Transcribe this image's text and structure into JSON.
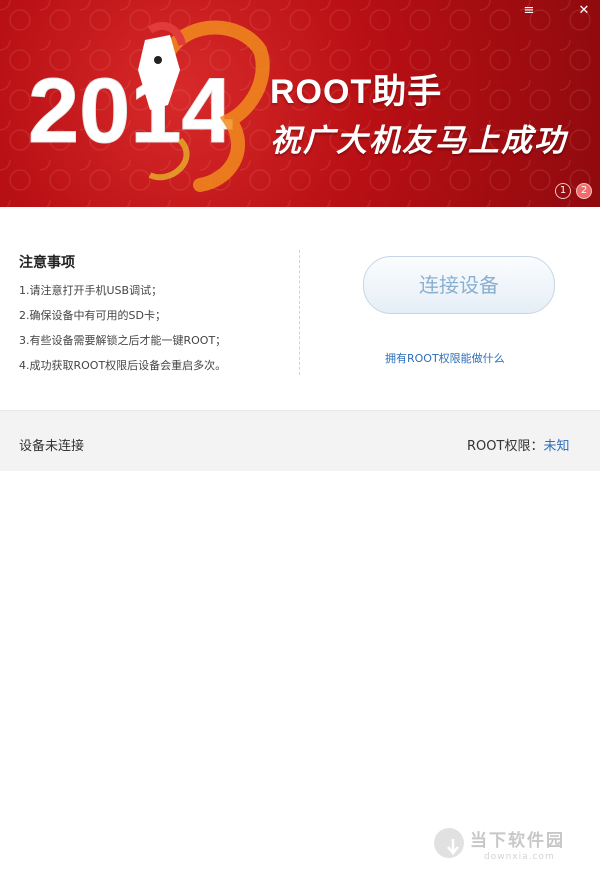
{
  "window": {
    "menu_icon_label": "≡",
    "close_icon_label": "✕"
  },
  "banner": {
    "year": "2014",
    "title": "ROOT助手",
    "slogan": "祝广大机友马上成功",
    "pages": [
      "1",
      "2"
    ],
    "active_page": 2
  },
  "notes": {
    "title": "注意事项",
    "items": [
      "1.请注意打开手机USB调试；",
      "2.确保设备中有可用的SD卡；",
      "3.有些设备需要解锁之后才能一键ROOT；",
      "4.成功获取ROOT权限后设备会重启多次。"
    ]
  },
  "actions": {
    "connect_label": "连接设备",
    "root_link": "拥有ROOT权限能做什么"
  },
  "status": {
    "device_status": "设备未连接",
    "root_label": "ROOT权限：",
    "root_value": "未知"
  },
  "watermark": {
    "name": "当下软件园",
    "url": "downxia.com"
  },
  "colors": {
    "banner_red": "#b80f14",
    "link_blue": "#2f6fb8",
    "button_text": "#8ab0d0"
  }
}
